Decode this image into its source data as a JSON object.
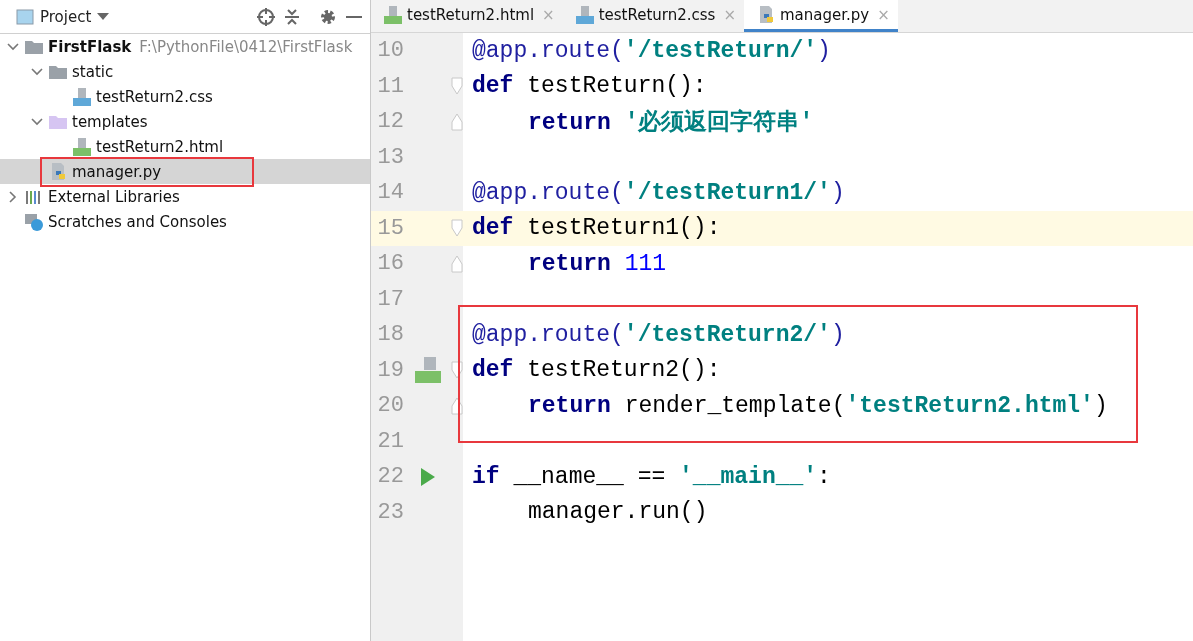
{
  "project_panel": {
    "title": "Project",
    "tree": [
      {
        "label": "FirstFlask",
        "path": "F:\\PythonFile\\0412\\FirstFlask",
        "kind": "project",
        "expanded": true,
        "selected": false,
        "boxed": false,
        "children": [
          {
            "label": "static",
            "kind": "folder",
            "expanded": true,
            "selected": false,
            "boxed": false,
            "children": [
              {
                "label": "testReturn2.css",
                "kind": "css",
                "selected": false,
                "boxed": false
              }
            ]
          },
          {
            "label": "templates",
            "kind": "templates",
            "expanded": true,
            "selected": false,
            "boxed": false,
            "children": [
              {
                "label": "testReturn2.html",
                "kind": "html",
                "selected": false,
                "boxed": false
              }
            ]
          },
          {
            "label": "manager.py",
            "kind": "python",
            "selected": true,
            "boxed": true
          }
        ]
      },
      {
        "label": "External Libraries",
        "kind": "library",
        "expanded": false,
        "selected": false,
        "boxed": false
      },
      {
        "label": "Scratches and Consoles",
        "kind": "scratches",
        "selected": false,
        "boxed": false
      }
    ]
  },
  "tabs": [
    {
      "label": "testReturn2.html",
      "kind": "html",
      "close": "×",
      "selected": false
    },
    {
      "label": "testReturn2.css",
      "kind": "css",
      "close": "×",
      "selected": false
    },
    {
      "label": "manager.py",
      "kind": "python",
      "close": "×",
      "selected": true
    }
  ],
  "editor": {
    "lines": [
      {
        "number": "10",
        "current": false,
        "boxed": false,
        "indent": false,
        "tokens": [
          {
            "decorator": "@app.route("
          },
          {
            "string": "'/testReturn/'"
          },
          {
            "decorator": ")"
          }
        ]
      },
      {
        "number": "11",
        "current": false,
        "boxed": false,
        "indent": false,
        "fold_start": true,
        "tokens": [
          {
            "keyword": "def "
          },
          {
            "plain": "testReturn():"
          }
        ]
      },
      {
        "number": "12",
        "current": false,
        "boxed": false,
        "indent": true,
        "fold_end": true,
        "tokens": [
          {
            "keyword": "return "
          },
          {
            "string": "'必须返回字符串'"
          }
        ]
      },
      {
        "number": "13",
        "current": false,
        "boxed": false
      },
      {
        "number": "14",
        "current": false,
        "boxed": false,
        "indent": false,
        "tokens": [
          {
            "decorator": "@app.route("
          },
          {
            "string": "'/testReturn1/'"
          },
          {
            "decorator": ")"
          }
        ]
      },
      {
        "number": "15",
        "current": true,
        "boxed": false,
        "indent": false,
        "fold_start": true,
        "tokens": [
          {
            "keyword": "def "
          },
          {
            "plain": "testReturn1():"
          }
        ]
      },
      {
        "number": "16",
        "current": false,
        "boxed": false,
        "indent": true,
        "fold_end": true,
        "tokens": [
          {
            "keyword": "return "
          },
          {
            "number": "111"
          }
        ]
      },
      {
        "number": "17",
        "current": false,
        "boxed": false
      },
      {
        "number": "18",
        "current": false,
        "boxed": true,
        "indent": false,
        "tokens": [
          {
            "decorator": "@app.route("
          },
          {
            "string": "'/testReturn2/'"
          },
          {
            "decorator": ")"
          }
        ]
      },
      {
        "number": "19",
        "current": false,
        "boxed": true,
        "indent": false,
        "fold_start": true,
        "html_marker": true,
        "tokens": [
          {
            "keyword": "def "
          },
          {
            "plain": "testReturn2():"
          }
        ]
      },
      {
        "number": "20",
        "current": false,
        "boxed": true,
        "indent": true,
        "fold_end": true,
        "tokens": [
          {
            "keyword": "return "
          },
          {
            "plain": "render_template("
          },
          {
            "string": "'testReturn2.html'"
          },
          {
            "plain": ")"
          }
        ]
      },
      {
        "number": "21",
        "current": false,
        "boxed": false
      },
      {
        "number": "22",
        "current": false,
        "boxed": false,
        "indent": false,
        "run_marker": true,
        "tokens": [
          {
            "keyword": "if "
          },
          {
            "plain": "__name__ == "
          },
          {
            "string": "'__main__'"
          },
          {
            "plain": ":"
          }
        ]
      },
      {
        "number": "23",
        "current": false,
        "boxed": false,
        "indent": true,
        "tokens": [
          {
            "plain": "manager.run()"
          }
        ]
      }
    ]
  }
}
